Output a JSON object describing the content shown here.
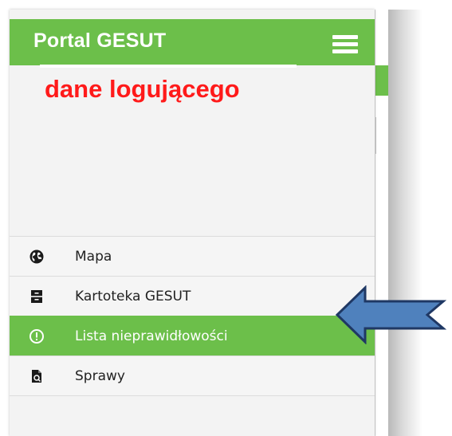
{
  "header": {
    "title": "Portal GESUT",
    "menu_icon": "hamburger-menu-icon"
  },
  "user": {
    "info_text": "dane logującego",
    "info_color": "#ff1a1a"
  },
  "colors": {
    "brand_green": "#6cbf4a",
    "arrow_fill": "#4f81bd",
    "arrow_stroke": "#1f3864"
  },
  "nav": {
    "items": [
      {
        "label": "Mapa",
        "icon": "globe-icon",
        "active": false
      },
      {
        "label": "Kartoteka GESUT",
        "icon": "archive-icon",
        "active": false
      },
      {
        "label": "Lista nieprawidłowości",
        "icon": "warning-circle-icon",
        "active": true
      },
      {
        "label": "Sprawy",
        "icon": "document-search-icon",
        "active": false
      }
    ]
  },
  "annotation": {
    "arrow_icon": "arrow-left-icon"
  }
}
